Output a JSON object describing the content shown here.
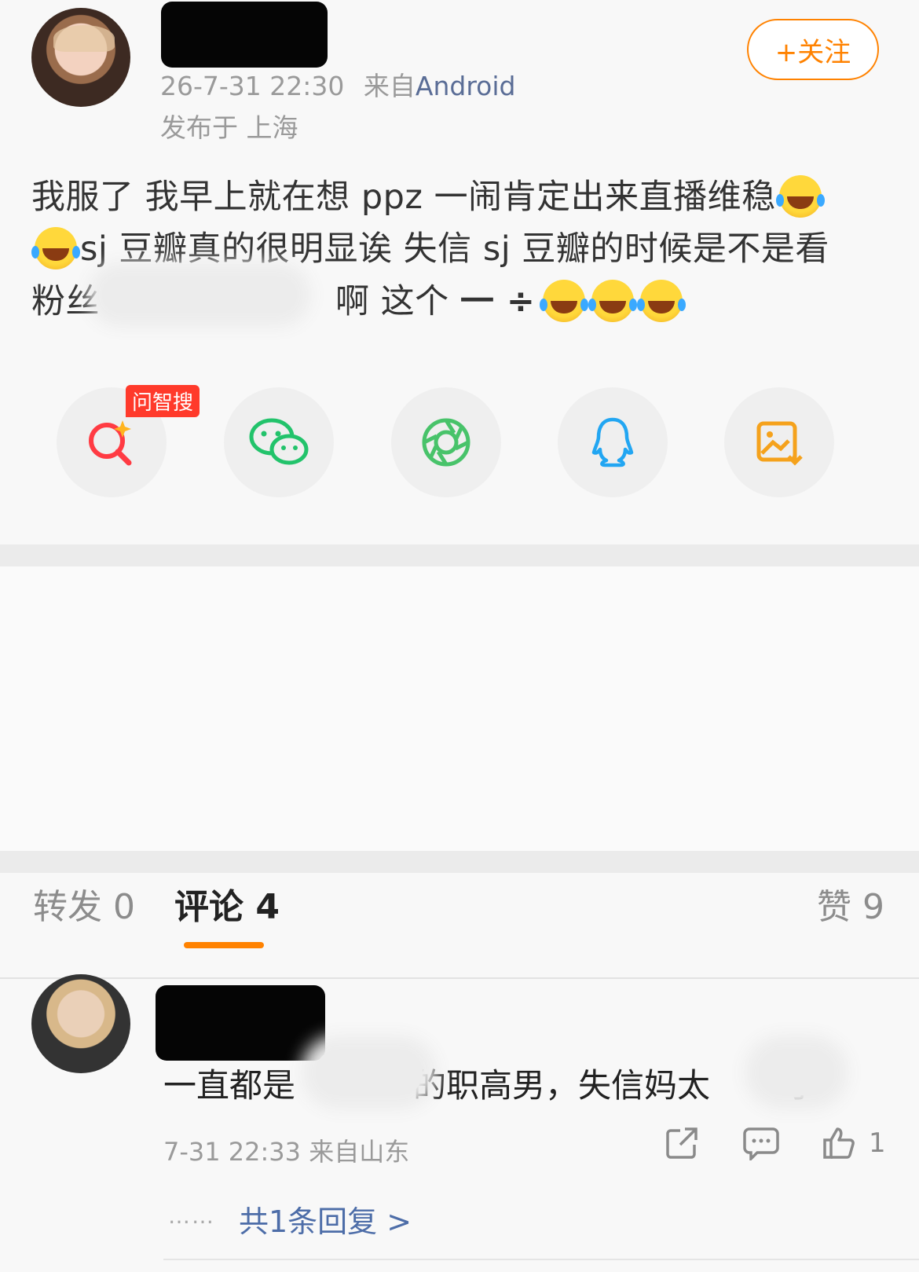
{
  "post": {
    "timestamp": "26-7-31 22:30",
    "source_prefix": "来自",
    "source": "Android",
    "location": "发布于 上海",
    "follow_label": "+关注",
    "line1": "我服了 我早上就在想 ppz 一闹肯定出来直播维稳",
    "line2": "sj 豆瓣真的很明显诶 失信 sj 豆瓣的时候是不是看",
    "line3_start": "粉丝",
    "line3_mid": "啊 这个 ",
    "line3_symbols": "一 ÷"
  },
  "share": {
    "badge": "问智搜",
    "items": [
      {
        "icon": "ai-search-icon",
        "color": "#ff3b43"
      },
      {
        "icon": "wechat-icon",
        "color": "#22c36b"
      },
      {
        "icon": "moments-icon",
        "color": "#48c36a"
      },
      {
        "icon": "qq-icon",
        "color": "#22a6f2"
      },
      {
        "icon": "save-image-icon",
        "color": "#f5a21c"
      }
    ]
  },
  "tabs": {
    "repost": "转发 0",
    "comments": "评论 4",
    "likes": "赞 9"
  },
  "comment": {
    "text_start": "一直都是",
    "text_mid": "的职高男，失信妈太",
    "text_end": "了",
    "meta": "7-31 22:33  来自山东",
    "like_count": "1",
    "reply_dots": "……",
    "reply_link": "共1条回复 >"
  },
  "colors": {
    "accent": "#ff8200",
    "link": "#4d6da8",
    "badge": "#ff3a2b"
  }
}
